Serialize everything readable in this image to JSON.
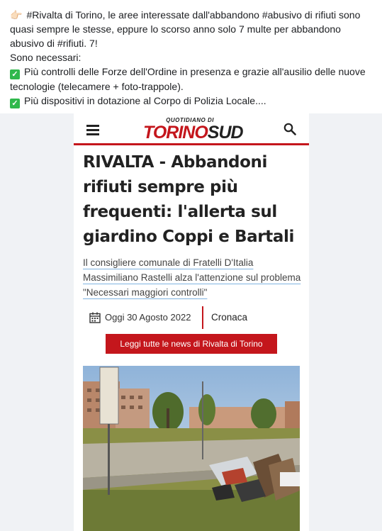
{
  "post": {
    "line1": "#Rivalta di Torino, le aree interessate dall'abbandono #abusivo di rifiuti sono quasi sempre le stesse, eppure lo scorso anno solo 7 multe per abbandono abusivo di #rifiuti. 7!",
    "line2": "Sono necessari:",
    "line3": "Più controlli delle Forze dell'Ordine in presenza e grazie all'ausilio delle nuove tecnologie (telecamere + foto-trappole).",
    "line4": "Più dispositivi in dotazione al Corpo di Polizia Locale...."
  },
  "site": {
    "logo_small": "QUOTIDIANO DI",
    "logo_torino": "TORINO",
    "logo_sud": "SUD"
  },
  "article": {
    "headline": "RIVALTA - Abbandoni rifiuti sempre più frequenti: l'allerta sul giardino Coppi e Bartali",
    "subtitle": "Il consigliere comunale di Fratelli D'Italia Massimiliano Rastelli alza l'attenzione sul problema \"Necessari maggiori controlli\"",
    "date": "Oggi 30 Agosto 2022",
    "category": "Cronaca",
    "button": "Leggi tutte le news di Rivalta di Torino"
  },
  "icons": {
    "hand": "pointing-hand-icon",
    "check": "check-mark-icon",
    "menu": "menu-icon",
    "search": "search-icon",
    "calendar": "calendar-icon"
  },
  "colors": {
    "accent_red": "#c4161c",
    "check_green": "#30b84c",
    "underline_blue": "#7fb3e0"
  }
}
